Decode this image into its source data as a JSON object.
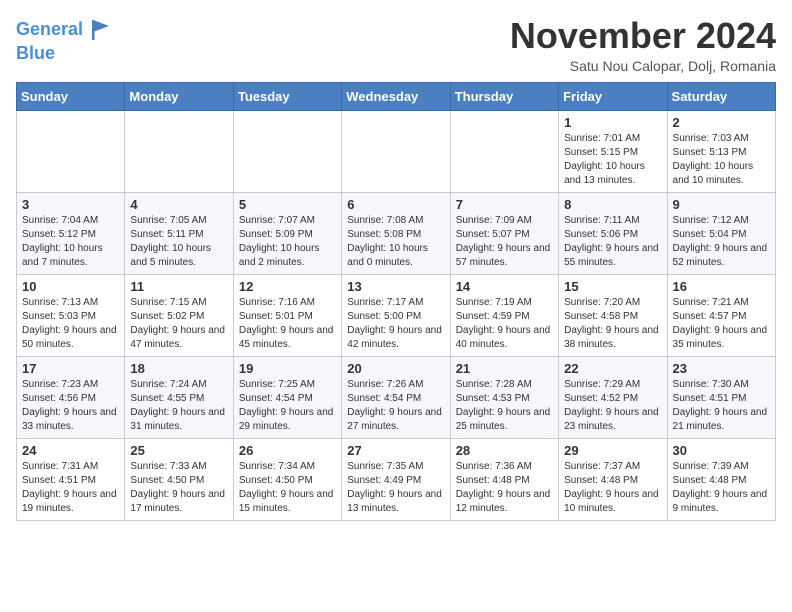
{
  "header": {
    "logo_line1": "General",
    "logo_line2": "Blue",
    "month": "November 2024",
    "location": "Satu Nou Calopar, Dolj, Romania"
  },
  "days_of_week": [
    "Sunday",
    "Monday",
    "Tuesday",
    "Wednesday",
    "Thursday",
    "Friday",
    "Saturday"
  ],
  "weeks": [
    [
      {
        "day": "",
        "info": ""
      },
      {
        "day": "",
        "info": ""
      },
      {
        "day": "",
        "info": ""
      },
      {
        "day": "",
        "info": ""
      },
      {
        "day": "",
        "info": ""
      },
      {
        "day": "1",
        "info": "Sunrise: 7:01 AM\nSunset: 5:15 PM\nDaylight: 10 hours\nand 13 minutes."
      },
      {
        "day": "2",
        "info": "Sunrise: 7:03 AM\nSunset: 5:13 PM\nDaylight: 10 hours\nand 10 minutes."
      }
    ],
    [
      {
        "day": "3",
        "info": "Sunrise: 7:04 AM\nSunset: 5:12 PM\nDaylight: 10 hours\nand 7 minutes."
      },
      {
        "day": "4",
        "info": "Sunrise: 7:05 AM\nSunset: 5:11 PM\nDaylight: 10 hours\nand 5 minutes."
      },
      {
        "day": "5",
        "info": "Sunrise: 7:07 AM\nSunset: 5:09 PM\nDaylight: 10 hours\nand 2 minutes."
      },
      {
        "day": "6",
        "info": "Sunrise: 7:08 AM\nSunset: 5:08 PM\nDaylight: 10 hours\nand 0 minutes."
      },
      {
        "day": "7",
        "info": "Sunrise: 7:09 AM\nSunset: 5:07 PM\nDaylight: 9 hours\nand 57 minutes."
      },
      {
        "day": "8",
        "info": "Sunrise: 7:11 AM\nSunset: 5:06 PM\nDaylight: 9 hours\nand 55 minutes."
      },
      {
        "day": "9",
        "info": "Sunrise: 7:12 AM\nSunset: 5:04 PM\nDaylight: 9 hours\nand 52 minutes."
      }
    ],
    [
      {
        "day": "10",
        "info": "Sunrise: 7:13 AM\nSunset: 5:03 PM\nDaylight: 9 hours\nand 50 minutes."
      },
      {
        "day": "11",
        "info": "Sunrise: 7:15 AM\nSunset: 5:02 PM\nDaylight: 9 hours\nand 47 minutes."
      },
      {
        "day": "12",
        "info": "Sunrise: 7:16 AM\nSunset: 5:01 PM\nDaylight: 9 hours\nand 45 minutes."
      },
      {
        "day": "13",
        "info": "Sunrise: 7:17 AM\nSunset: 5:00 PM\nDaylight: 9 hours\nand 42 minutes."
      },
      {
        "day": "14",
        "info": "Sunrise: 7:19 AM\nSunset: 4:59 PM\nDaylight: 9 hours\nand 40 minutes."
      },
      {
        "day": "15",
        "info": "Sunrise: 7:20 AM\nSunset: 4:58 PM\nDaylight: 9 hours\nand 38 minutes."
      },
      {
        "day": "16",
        "info": "Sunrise: 7:21 AM\nSunset: 4:57 PM\nDaylight: 9 hours\nand 35 minutes."
      }
    ],
    [
      {
        "day": "17",
        "info": "Sunrise: 7:23 AM\nSunset: 4:56 PM\nDaylight: 9 hours\nand 33 minutes."
      },
      {
        "day": "18",
        "info": "Sunrise: 7:24 AM\nSunset: 4:55 PM\nDaylight: 9 hours\nand 31 minutes."
      },
      {
        "day": "19",
        "info": "Sunrise: 7:25 AM\nSunset: 4:54 PM\nDaylight: 9 hours\nand 29 minutes."
      },
      {
        "day": "20",
        "info": "Sunrise: 7:26 AM\nSunset: 4:54 PM\nDaylight: 9 hours\nand 27 minutes."
      },
      {
        "day": "21",
        "info": "Sunrise: 7:28 AM\nSunset: 4:53 PM\nDaylight: 9 hours\nand 25 minutes."
      },
      {
        "day": "22",
        "info": "Sunrise: 7:29 AM\nSunset: 4:52 PM\nDaylight: 9 hours\nand 23 minutes."
      },
      {
        "day": "23",
        "info": "Sunrise: 7:30 AM\nSunset: 4:51 PM\nDaylight: 9 hours\nand 21 minutes."
      }
    ],
    [
      {
        "day": "24",
        "info": "Sunrise: 7:31 AM\nSunset: 4:51 PM\nDaylight: 9 hours\nand 19 minutes."
      },
      {
        "day": "25",
        "info": "Sunrise: 7:33 AM\nSunset: 4:50 PM\nDaylight: 9 hours\nand 17 minutes."
      },
      {
        "day": "26",
        "info": "Sunrise: 7:34 AM\nSunset: 4:50 PM\nDaylight: 9 hours\nand 15 minutes."
      },
      {
        "day": "27",
        "info": "Sunrise: 7:35 AM\nSunset: 4:49 PM\nDaylight: 9 hours\nand 13 minutes."
      },
      {
        "day": "28",
        "info": "Sunrise: 7:36 AM\nSunset: 4:48 PM\nDaylight: 9 hours\nand 12 minutes."
      },
      {
        "day": "29",
        "info": "Sunrise: 7:37 AM\nSunset: 4:48 PM\nDaylight: 9 hours\nand 10 minutes."
      },
      {
        "day": "30",
        "info": "Sunrise: 7:39 AM\nSunset: 4:48 PM\nDaylight: 9 hours\nand 9 minutes."
      }
    ]
  ]
}
